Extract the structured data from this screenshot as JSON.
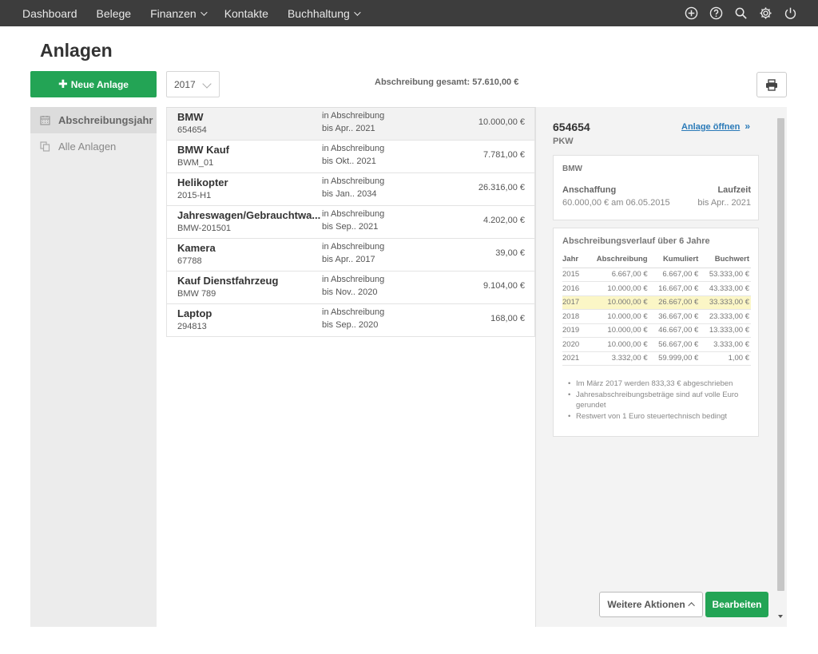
{
  "nav": {
    "items": [
      {
        "label": "Dashboard",
        "dropdown": false
      },
      {
        "label": "Belege",
        "dropdown": false
      },
      {
        "label": "Finanzen",
        "dropdown": true
      },
      {
        "label": "Kontakte",
        "dropdown": false
      },
      {
        "label": "Buchhaltung",
        "dropdown": true
      }
    ],
    "icons": [
      "plus-circle-icon",
      "help-icon",
      "search-icon",
      "gear-icon",
      "power-icon"
    ]
  },
  "page": {
    "title": "Anlagen",
    "new_button": "Neue Anlage",
    "year": "2017",
    "total": "Abschreibung gesamt: 57.610,00 €"
  },
  "sidebar": {
    "items": [
      {
        "label": "Abschreibungsjahr",
        "icon": "calendar-icon",
        "active": true
      },
      {
        "label": "Alle Anlagen",
        "icon": "copy-icon",
        "active": false
      }
    ]
  },
  "assets": [
    {
      "name": "BMW",
      "code": "654654",
      "status": "in Abschreibung",
      "until": "bis Apr.. 2021",
      "amount": "10.000,00 €"
    },
    {
      "name": "BMW Kauf",
      "code": "BWM_01",
      "status": "in Abschreibung",
      "until": "bis Okt.. 2021",
      "amount": "7.781,00 €"
    },
    {
      "name": "Helikopter",
      "code": "2015-H1",
      "status": "in Abschreibung",
      "until": "bis Jan.. 2034",
      "amount": "26.316,00 €"
    },
    {
      "name": "Jahreswagen/Gebrauchtwa...",
      "code": "BMW-201501",
      "status": "in Abschreibung",
      "until": "bis Sep.. 2021",
      "amount": "4.202,00 €"
    },
    {
      "name": "Kamera",
      "code": "67788",
      "status": "in Abschreibung",
      "until": "bis Apr.. 2017",
      "amount": "39,00 €"
    },
    {
      "name": "Kauf Dienstfahrzeug",
      "code": "BMW 789",
      "status": "in Abschreibung",
      "until": "bis Nov.. 2020",
      "amount": "9.104,00 €"
    },
    {
      "name": "Laptop",
      "code": "294813",
      "status": "in Abschreibung",
      "until": "bis Sep.. 2020",
      "amount": "168,00 €"
    }
  ],
  "detail": {
    "id": "654654",
    "type": "PKW",
    "open_link": "Anlage öffnen",
    "card": {
      "name": "BMW",
      "acq_label": "Anschaffung",
      "acq_value": "60.000,00 € am 06.05.2015",
      "term_label": "Laufzeit",
      "term_value": "bis Apr.. 2021"
    },
    "schedule": {
      "title": "Abschreibungsverlauf über 6 Jahre",
      "headers": [
        "Jahr",
        "Abschreibung",
        "Kumuliert",
        "Buchwert"
      ],
      "rows": [
        [
          "2015",
          "6.667,00 €",
          "6.667,00 €",
          "53.333,00 €"
        ],
        [
          "2016",
          "10.000,00 €",
          "16.667,00 €",
          "43.333,00 €"
        ],
        [
          "2017",
          "10.000,00 €",
          "26.667,00 €",
          "33.333,00 €"
        ],
        [
          "2018",
          "10.000,00 €",
          "36.667,00 €",
          "23.333,00 €"
        ],
        [
          "2019",
          "10.000,00 €",
          "46.667,00 €",
          "13.333,00 €"
        ],
        [
          "2020",
          "10.000,00 €",
          "56.667,00 €",
          "3.333,00 €"
        ],
        [
          "2021",
          "3.332,00 €",
          "59.999,00 €",
          "1,00 €"
        ]
      ],
      "highlight_year": "2017"
    },
    "notes": [
      "Im März 2017 werden 833,33 € abgeschrieben",
      "Jahresabschreibungsbeträge sind auf volle Euro gerundet",
      "Restwert von 1 Euro steuertechnisch bedingt"
    ],
    "more_button": "Weitere Aktionen",
    "edit_button": "Bearbeiten"
  },
  "colors": {
    "accent": "#23a455",
    "link": "#2a7ab8",
    "highlight": "#fbf6c6",
    "topbar": "#3d3d3d"
  }
}
